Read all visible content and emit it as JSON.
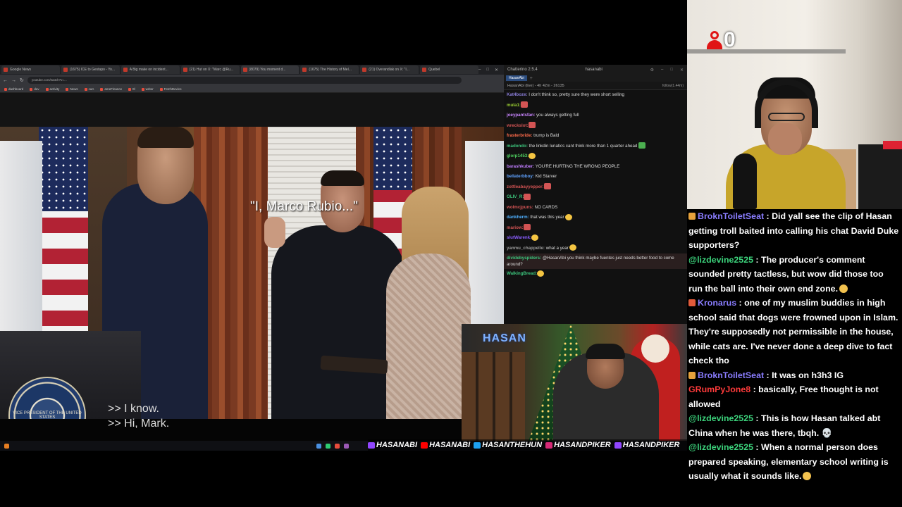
{
  "browser": {
    "tabs": [
      {
        "title": "Google News"
      },
      {
        "title": "(1675) ICE to Gestapo - Yo..."
      },
      {
        "title": "A Big make on incident..."
      },
      {
        "title": "(21) Hut on X: \"Marc @Ru..."
      },
      {
        "title": "(8079) You moment d..."
      },
      {
        "title": "(1675) The History of Mel..."
      },
      {
        "title": "(21) Overandlak on X: \"I..."
      },
      {
        "title": "Quebel"
      }
    ],
    "url": "youtube.com/watch?v=...",
    "bookmarks": [
      "dashboard",
      "dev",
      "activity",
      "News",
      "caA",
      "ameFinance",
      "ttl",
      "writer",
      "FetchDevice"
    ]
  },
  "video": {
    "quote": "\"I, Marco Rubio...\"",
    "captions": [
      ">> I know.",
      ">> Hi, Mark."
    ],
    "seal_text": "VICE PRESIDENT OF THE UNITED STATES"
  },
  "chatterino": {
    "app_title": "Chatterino 2.5.4",
    "channel_label": "hasanabi",
    "tab": "HasanAbi",
    "stream_info": "HasanAbi (live) - 4h 42m - 26135",
    "followers": "follow(1.44m)",
    "messages": [
      {
        "user": "Kat4boze",
        "color": "#8a7dd8",
        "text": "I don't think so, pretty sure they were short selling"
      },
      {
        "user": "mula1",
        "color": "#9acd32",
        "text": "",
        "emote": "red"
      },
      {
        "user": "joeypantsfan",
        "color": "#c985ff",
        "text": "you always getting full"
      },
      {
        "user": "wreckslot",
        "color": "#d35454",
        "text": "",
        "emote": "red"
      },
      {
        "user": "frasterbride",
        "color": "#ff6b4a",
        "text": "trump is Bald"
      },
      {
        "user": "madondo",
        "color": "#3cc47c",
        "text": "the linkdin lunatics cant think more than 1 quarter ahead",
        "emote": "green"
      },
      {
        "user": "glorp1453",
        "color": "#4fd160",
        "text": "",
        "emote": "yellow"
      },
      {
        "user": "barashkuber",
        "color": "#c07dff",
        "text": "YOU'RE HURTING THE WRONG PEOPLE"
      },
      {
        "user": "bellaterbboy",
        "color": "#5fa2ff",
        "text": "Kid Starver"
      },
      {
        "user": "zottleabayyepper",
        "color": "#d35454",
        "text": "",
        "emote": "red"
      },
      {
        "user": "OLIV_R",
        "color": "#3cc47c",
        "text": "",
        "emote": "red"
      },
      {
        "user": "wolmcjpuns",
        "color": "#d35454",
        "text": "NO CARDS"
      },
      {
        "user": "dankherm",
        "color": "#4fb0ff",
        "text": "that was this year",
        "emote": "yellow"
      },
      {
        "user": "mariow",
        "color": "#d35454",
        "text": "",
        "emote": "red"
      },
      {
        "user": "slutWarenk",
        "color": "#8a5dff",
        "text": "",
        "emote": "yellow"
      },
      {
        "user": "yanmu_chappelle",
        "color": "#999999",
        "text": "what a year",
        "emote": "yellow"
      },
      {
        "user": "dividebyspiders",
        "color": "#3cc47c",
        "text": "@HasanAbi you think maybe fuentes just needs better food to come around?",
        "highlight": true
      },
      {
        "user": "WalkingBread",
        "color": "#3cc47c",
        "text": "",
        "emote": "yellow"
      }
    ]
  },
  "overlay": {
    "logo": "HASAN",
    "socials": [
      {
        "icon": "twitch-icon",
        "handle": "HASANABI"
      },
      {
        "icon": "youtube-icon",
        "handle": "HASANABI"
      },
      {
        "icon": "twitter-icon",
        "handle": "HASANTHEHUN"
      },
      {
        "icon": "instagram-icon",
        "handle": "HASANDPIKER"
      },
      {
        "icon": "tiktok-icon",
        "handle": "HASANDPIKER"
      }
    ]
  },
  "webcam": {
    "viewer_count": "0"
  },
  "overlay_chat": [
    {
      "user": "BroknToiletSeat",
      "color": "#8a7dff",
      "badge": "#e6a23c",
      "text": "Did yall see the clip of Hasan getting troll baited into calling his chat David Duke supporters?"
    },
    {
      "user": "@lizdevine2525",
      "color": "#3cd47c",
      "text": "The producer's comment sounded pretty tactless, but wow did those too run the ball into their own end zone.",
      "emote": true
    },
    {
      "user": "Kronarus",
      "color": "#8a7dff",
      "badge": "#e05a3a",
      "text": "one of my muslim buddies in high school said that dogs were frowned upon in Islam. They're supposedly not permissible in the house, while cats are. I've never done a deep dive to fact check tho"
    },
    {
      "user": "BroknToiletSeat",
      "color": "#8a7dff",
      "badge": "#e6a23c",
      "text": "It was on h3h3 IG"
    },
    {
      "user": "GRumPyJone8",
      "color": "#ff3b3b",
      "text": "basically, Free thought is not allowed"
    },
    {
      "user": "@lizdevine2525",
      "color": "#3cd47c",
      "text": "This is how Hasan talked abt China when he was there, tbqh. 💀"
    },
    {
      "user": "@lizdevine2525",
      "color": "#3cd47c",
      "text": "When a normal person does prepared speaking, elementary school writing is usually what it sounds like.",
      "emote": true
    }
  ],
  "colors": {
    "accent_red": "#e01515",
    "twitch_purple": "#9146ff"
  }
}
